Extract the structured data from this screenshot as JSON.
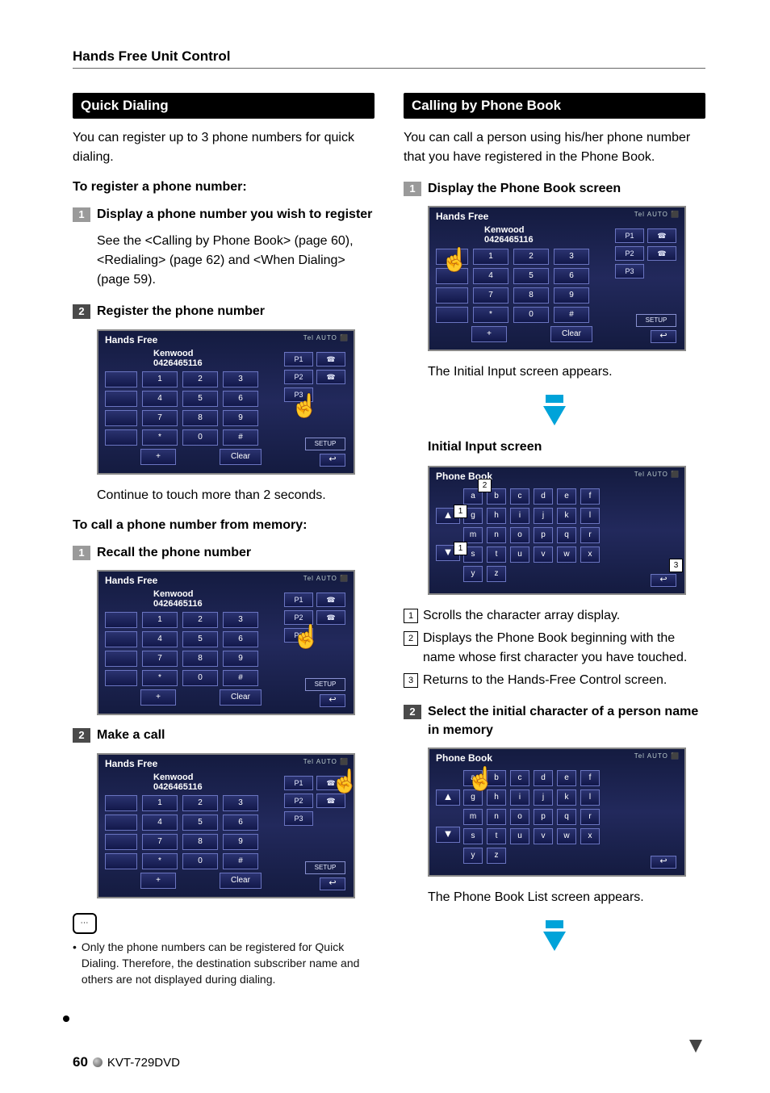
{
  "header": {
    "section": "Hands Free Unit Control"
  },
  "left": {
    "title": "Quick Dialing",
    "intro": "You can register up to 3 phone numbers for quick dialing.",
    "register_heading": "To register a phone number:",
    "step1_label": "Display a phone number you wish to register",
    "step1_sub": "See the <Calling by Phone Book> (page 60), <Redialing> (page 62) and <When Dialing> (page 59).",
    "step2_label": "Register the phone number",
    "step2_caption": "Continue to touch more than 2 seconds.",
    "call_heading": "To call a phone number from memory:",
    "recall_step1": "Recall the phone number",
    "recall_step2": "Make a call",
    "note_text": "Only the phone numbers can be registered for Quick Dialing. Therefore, the destination subscriber name and others are not displayed during dialing.",
    "step_nums": {
      "n1": "1",
      "n2": "2"
    }
  },
  "right": {
    "title": "Calling by Phone Book",
    "intro": "You can call a person using his/her phone number that you have registered in the Phone Book.",
    "step1_label": "Display the Phone Book screen",
    "after_step1": "The Initial Input screen appears.",
    "initial_heading": "Initial Input screen",
    "callout1": "Scrolls the character array display.",
    "callout2": "Displays the Phone Book beginning with the name whose first character you have touched.",
    "callout3": "Returns to the Hands-Free Control screen.",
    "step2_label": "Select the initial character of a person name in memory",
    "after_step2": "The Phone Book List screen appears.",
    "step_nums": {
      "n1": "1",
      "n2": "2"
    },
    "callout_nums": {
      "c1": "1",
      "c2": "2",
      "c3": "3"
    }
  },
  "shots": {
    "hands_free_title": "Hands Free",
    "kenwood": "Kenwood",
    "number": "0426465116",
    "status": "Tel   AUTO  ⬛",
    "pads": {
      "r1": [
        "1",
        "2",
        "3"
      ],
      "r2": [
        "4",
        "5",
        "6"
      ],
      "r3": [
        "7",
        "8",
        "9"
      ],
      "r4": [
        "*",
        "0",
        "#"
      ],
      "extra": "+",
      "clear": "Clear"
    },
    "p_labels": {
      "p1": "P1",
      "p2": "P2",
      "p3": "P3"
    },
    "setup": "SETUP",
    "return": "↩",
    "phone_book_title": "Phone Book",
    "keys": {
      "r1": [
        "a",
        "b",
        "c",
        "d",
        "e",
        "f"
      ],
      "r2": [
        "g",
        "h",
        "i",
        "j",
        "k",
        "l"
      ],
      "r3": [
        "m",
        "n",
        "o",
        "p",
        "q",
        "r"
      ],
      "r4": [
        "s",
        "t",
        "u",
        "v",
        "w",
        "x"
      ],
      "r5": [
        "y",
        "z"
      ]
    },
    "arrows": {
      "up": "▲",
      "down": "▼"
    }
  },
  "footer": {
    "page": "60",
    "model": "KVT-729DVD"
  }
}
